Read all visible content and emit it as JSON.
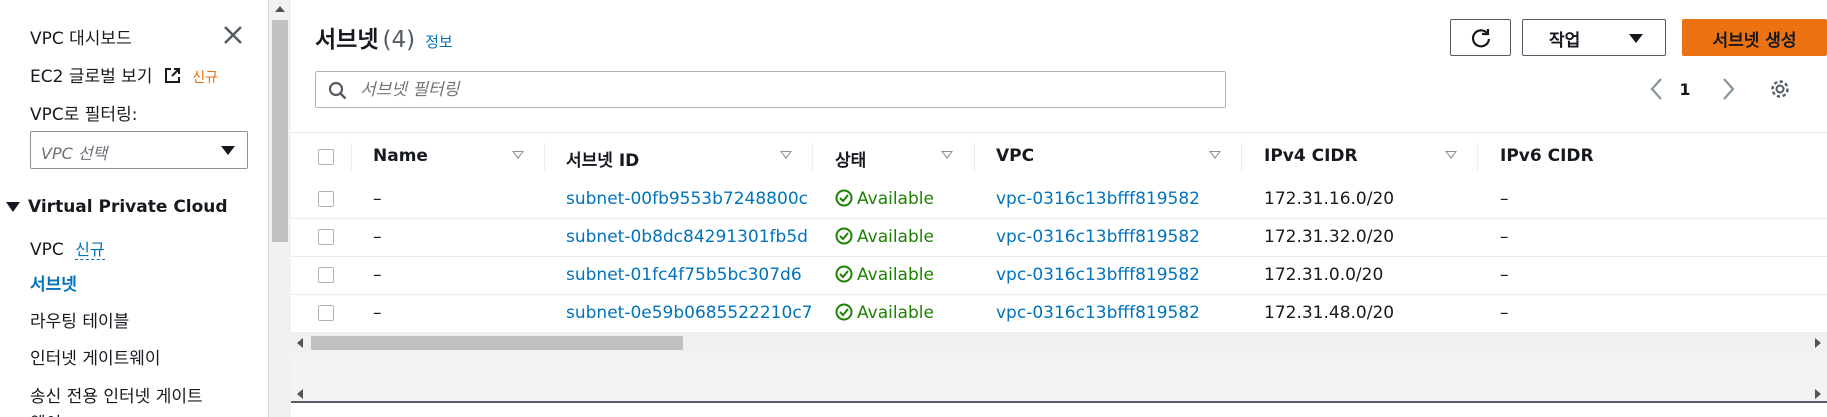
{
  "sidebar": {
    "dashboard": "VPC 대시보드",
    "ec2_global": "EC2 글로벌 보기",
    "new_badge": "신규",
    "filter_label": "VPC로 필터링:",
    "vpc_select_placeholder": "VPC 선택",
    "section_title": "Virtual Private Cloud",
    "items": [
      {
        "label": "VPC",
        "badge": "신규"
      },
      {
        "label": "서브넷"
      },
      {
        "label": "라우팅 테이블"
      },
      {
        "label": "인터넷 게이트웨이"
      },
      {
        "label": "송신 전용 인터넷 게이트"
      },
      {
        "label": "웨이"
      }
    ]
  },
  "header": {
    "title": "서브넷",
    "count": "(4)",
    "info": "정보",
    "actions_label": "작업",
    "create_label": "서브넷 생성"
  },
  "search": {
    "placeholder": "서브넷 필터링"
  },
  "pagination": {
    "current_page": "1"
  },
  "table": {
    "columns": [
      "Name",
      "서브넷 ID",
      "상태",
      "VPC",
      "IPv4 CIDR",
      "IPv6 CIDR"
    ],
    "rows": [
      {
        "name": "–",
        "subnet_id": "subnet-00fb9553b7248800c",
        "status": "Available",
        "vpc": "vpc-0316c13bfff819582",
        "ipv4": "172.31.16.0/20",
        "ipv6": "–"
      },
      {
        "name": "–",
        "subnet_id": "subnet-0b8dc84291301fb5d",
        "status": "Available",
        "vpc": "vpc-0316c13bfff819582",
        "ipv4": "172.31.32.0/20",
        "ipv6": "–"
      },
      {
        "name": "–",
        "subnet_id": "subnet-01fc4f75b5bc307d6",
        "status": "Available",
        "vpc": "vpc-0316c13bfff819582",
        "ipv4": "172.31.0.0/20",
        "ipv6": "–"
      },
      {
        "name": "–",
        "subnet_id": "subnet-0e59b0685522210c7",
        "status": "Available",
        "vpc": "vpc-0316c13bfff819582",
        "ipv4": "172.31.48.0/20",
        "ipv6": "–"
      }
    ]
  },
  "colors": {
    "link": "#0073bb",
    "available": "#1d8102",
    "primary_button": "#ec7211"
  }
}
